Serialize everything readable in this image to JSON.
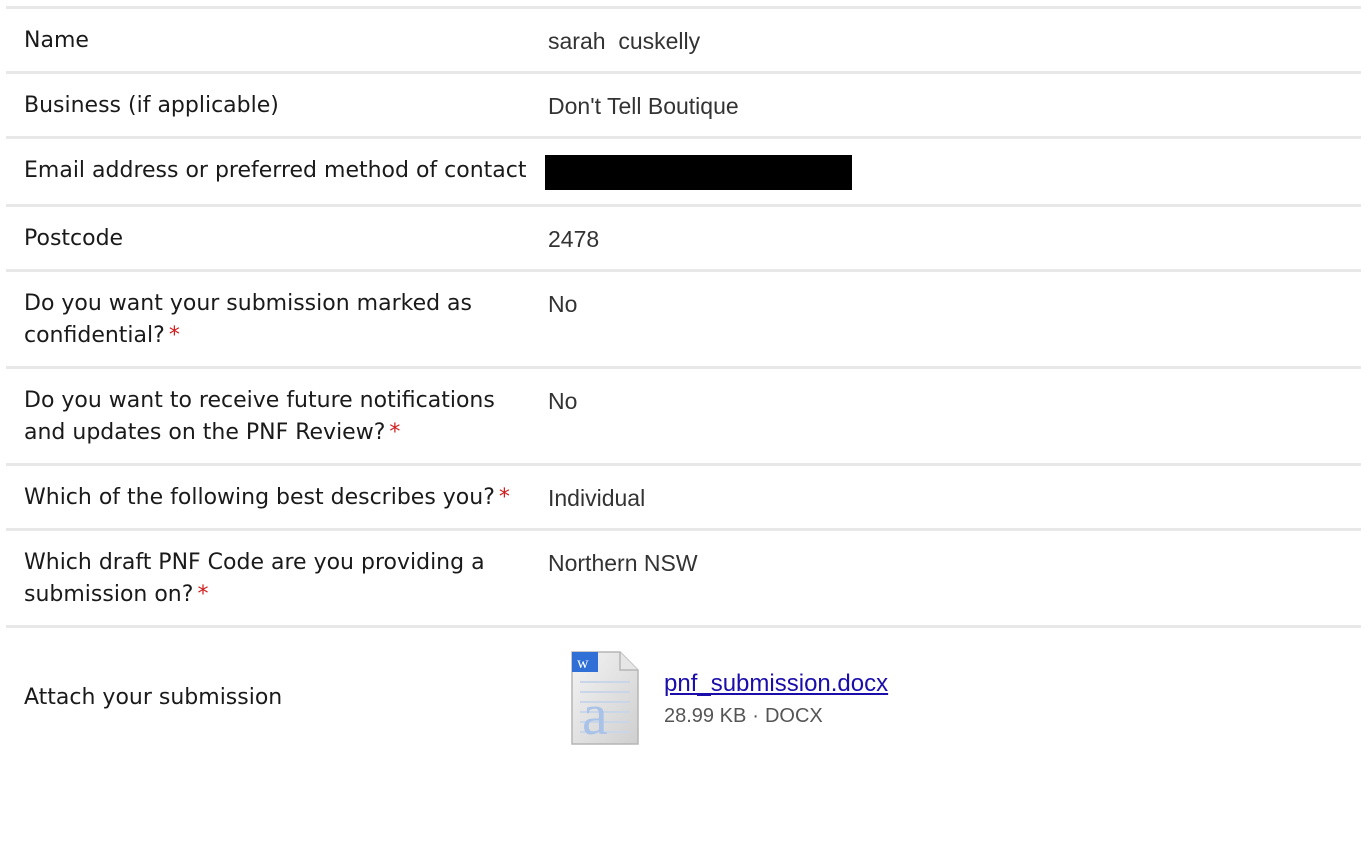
{
  "fields": [
    {
      "label": "Name",
      "value": "sarah  cuskelly",
      "required": ""
    },
    {
      "label": "Business (if applicable)",
      "value": "Don't Tell Boutique",
      "required": ""
    },
    {
      "label": "Email address or preferred method of contact",
      "value": "",
      "required": ""
    },
    {
      "label": "Postcode",
      "value": "2478",
      "required": ""
    },
    {
      "label": "Do you want your submission marked as confidential?",
      "value": "No",
      "required": "*"
    },
    {
      "label": "Do you want to receive future notifications and updates on the PNF Review?",
      "value": "No",
      "required": "*"
    },
    {
      "label": "Which of the following best describes you?",
      "value": "Individual",
      "required": "*"
    },
    {
      "label": "Which draft PNF Code are you providing a submission on?",
      "value": "Northern NSW",
      "required": "*"
    }
  ],
  "attachment": {
    "label": "Attach your submission",
    "file_name": "pnf_submission.docx",
    "file_size": "28.99 KB",
    "separator": "·",
    "file_type": "DOCX",
    "icon": "word-document-icon"
  },
  "colors": {
    "link": "#1a0dab",
    "required": "#d01d1d",
    "divider": "#e8e8e8",
    "redaction": "#000000"
  }
}
